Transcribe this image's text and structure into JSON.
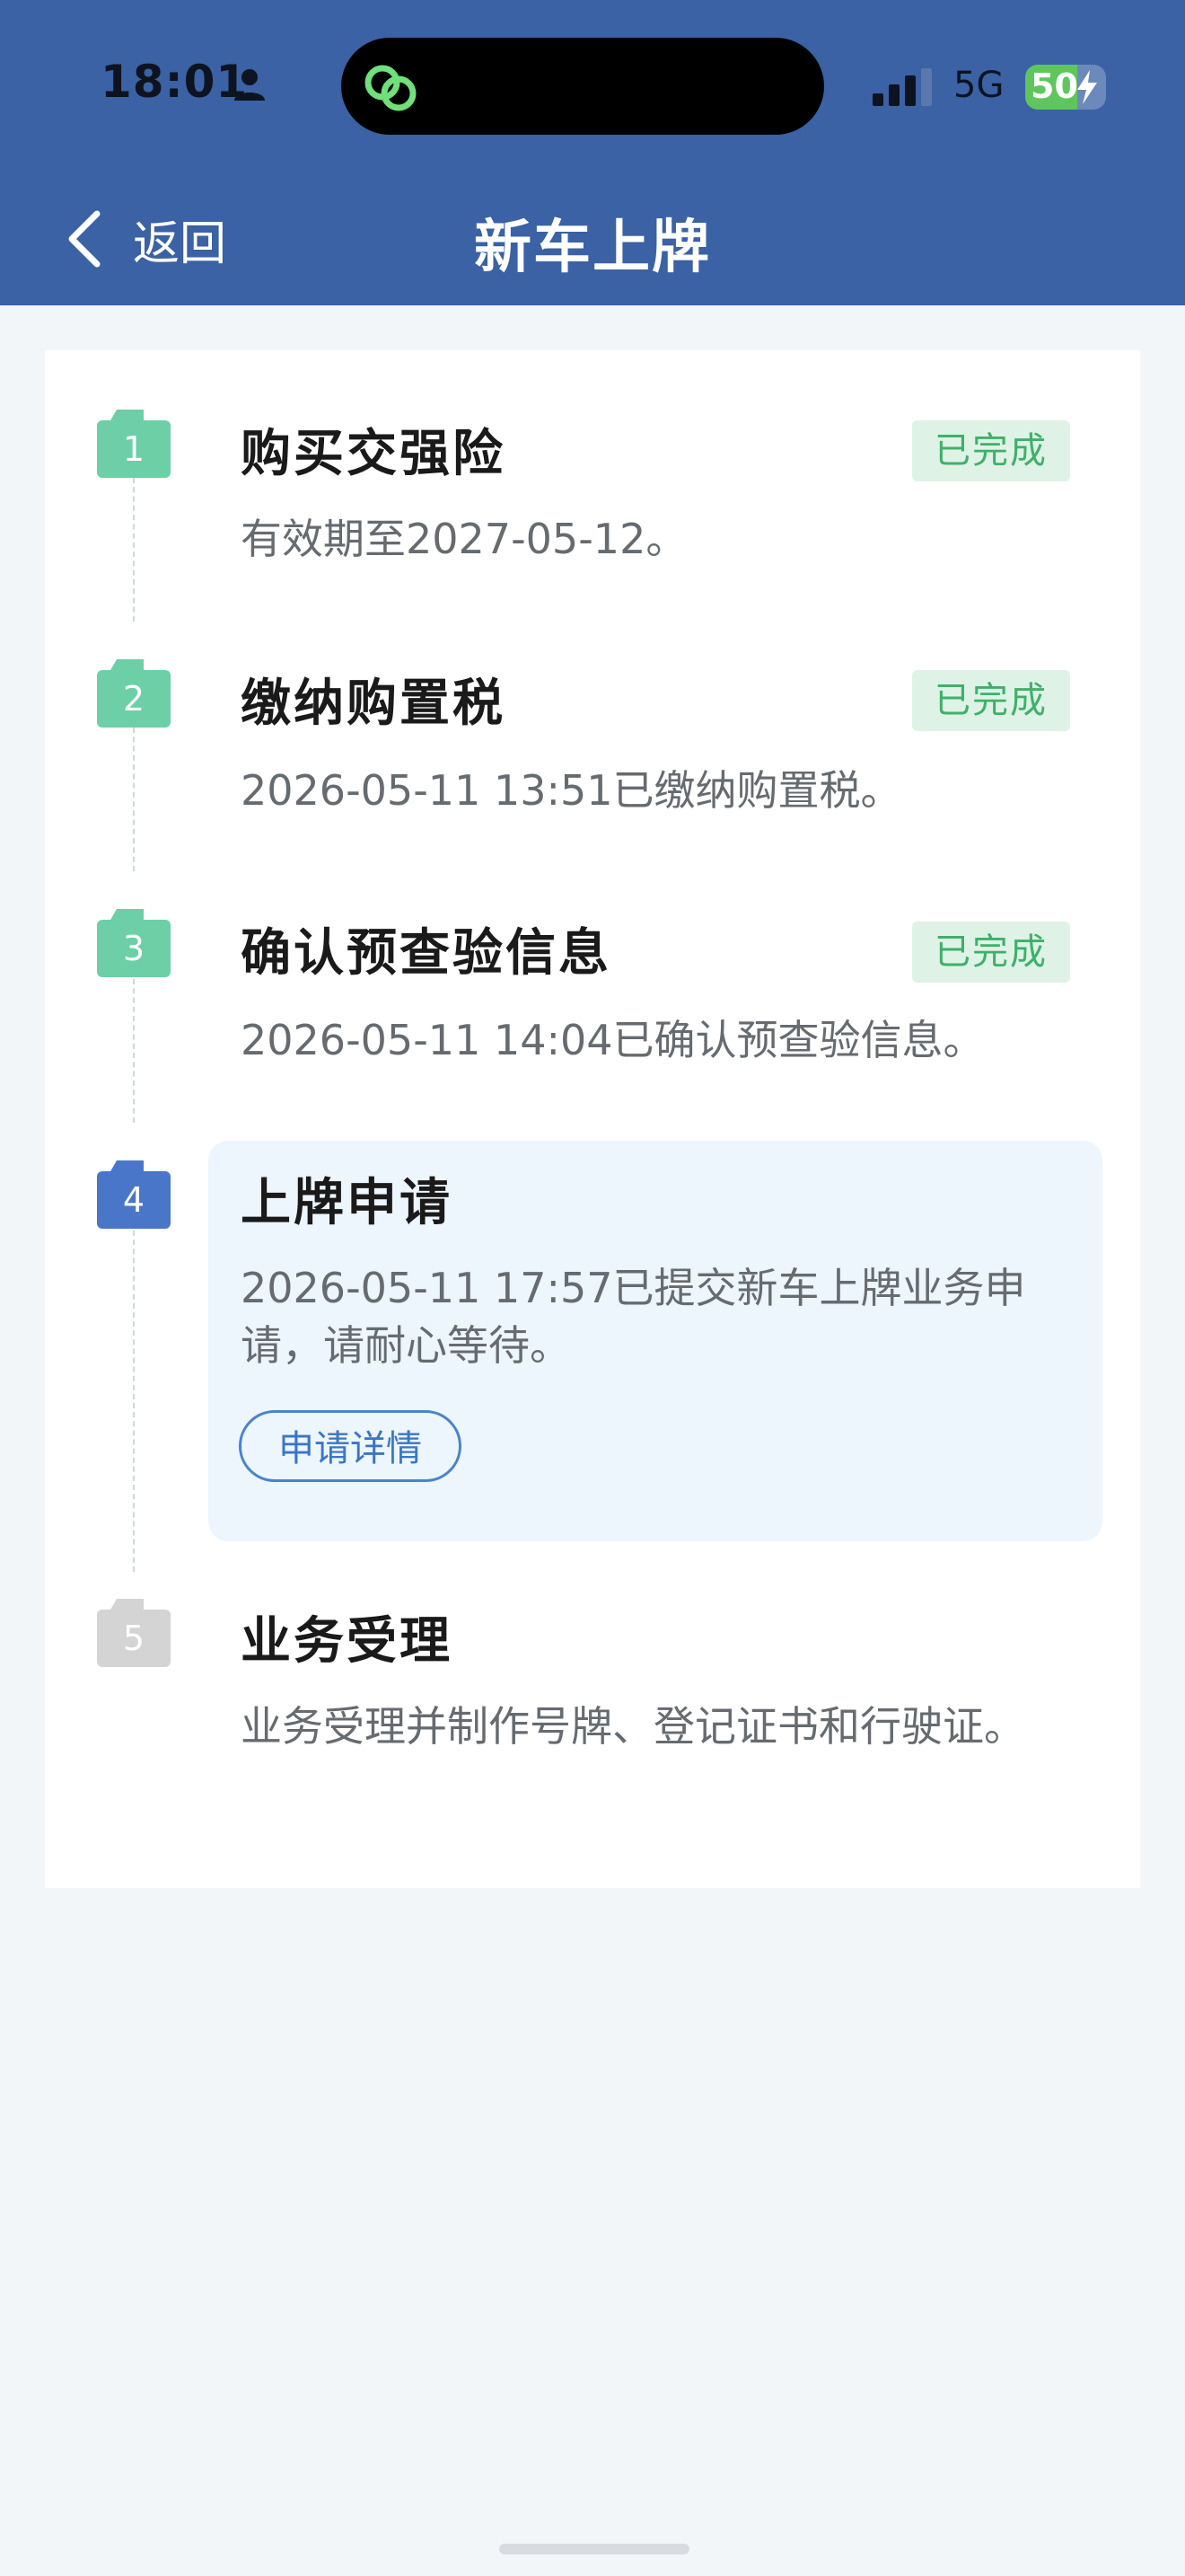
{
  "status_bar": {
    "time": "18:01",
    "network": "5G",
    "battery": "50",
    "battery_level_percent": 50
  },
  "nav": {
    "back_label": "返回",
    "title": "新车上牌"
  },
  "colors": {
    "header": "#3a62a4",
    "done": "#6dcfa6",
    "active": "#4a76c9",
    "pending": "#d4d4d4",
    "done_badge_bg": "#def3e6",
    "done_badge_text": "#3fb06a"
  },
  "steps": [
    {
      "number": "1",
      "title": "购买交强险",
      "description": "有效期至2027-05-12。",
      "status": "已完成",
      "state": "done"
    },
    {
      "number": "2",
      "title": "缴纳购置税",
      "description": "2026-05-11 13:51已缴纳购置税。",
      "status": "已完成",
      "state": "done"
    },
    {
      "number": "3",
      "title": "确认预查验信息",
      "description": "2026-05-11 14:04已确认预查验信息。",
      "status": "已完成",
      "state": "done"
    },
    {
      "number": "4",
      "title": "上牌申请",
      "description": "2026-05-11 17:57已提交新车上牌业务申请，请耐心等待。",
      "button_label": "申请详情",
      "state": "active"
    },
    {
      "number": "5",
      "title": "业务受理",
      "description": "业务受理并制作号牌、登记证书和行驶证。",
      "state": "pending"
    }
  ]
}
